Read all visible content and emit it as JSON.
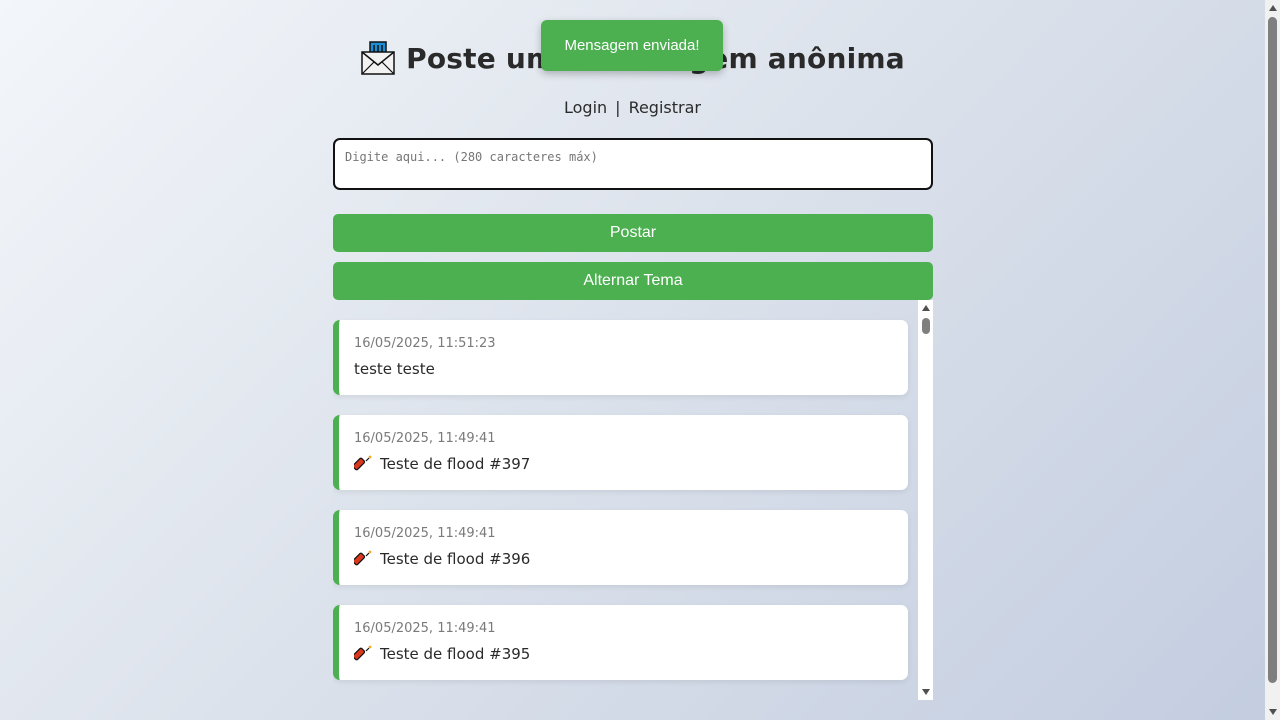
{
  "header": {
    "title": "Poste uma mensagem anônima",
    "icon": "envelope-icon"
  },
  "auth": {
    "login_label": "Login",
    "separator": "|",
    "register_label": "Registrar"
  },
  "composer": {
    "placeholder": "Digite aqui... (280 caracteres máx)",
    "value": ""
  },
  "buttons": {
    "post_label": "Postar",
    "theme_label": "Alternar Tema"
  },
  "toast": {
    "text": "Mensagem enviada!"
  },
  "messages": [
    {
      "time": "16/05/2025, 11:51:23",
      "text": "teste teste",
      "icon": null
    },
    {
      "time": "16/05/2025, 11:49:41",
      "text": "Teste de flood #397",
      "icon": "firecracker-icon"
    },
    {
      "time": "16/05/2025, 11:49:41",
      "text": "Teste de flood #396",
      "icon": "firecracker-icon"
    },
    {
      "time": "16/05/2025, 11:49:41",
      "text": "Teste de flood #395",
      "icon": "firecracker-icon"
    }
  ],
  "colors": {
    "accent": "#4caf50",
    "card_bg": "#ffffff",
    "timestamp": "#7a7a7a"
  }
}
